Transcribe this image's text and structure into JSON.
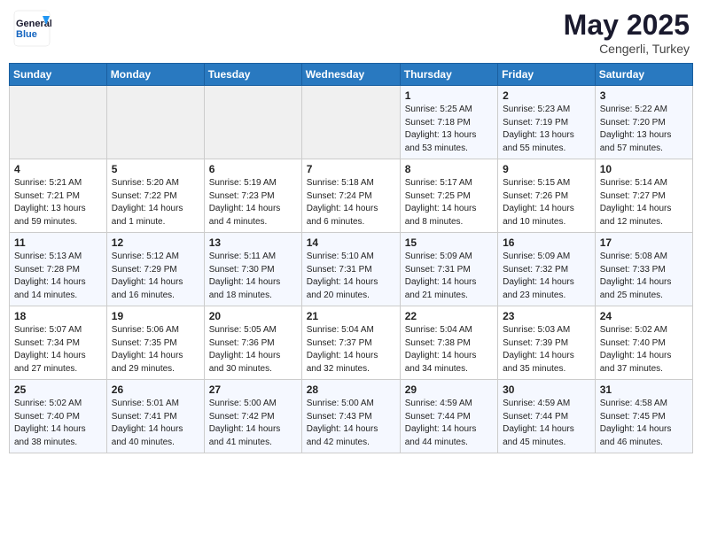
{
  "header": {
    "logo_line1": "General",
    "logo_line2": "Blue",
    "month_year": "May 2025",
    "location": "Cengerli, Turkey"
  },
  "days_of_week": [
    "Sunday",
    "Monday",
    "Tuesday",
    "Wednesday",
    "Thursday",
    "Friday",
    "Saturday"
  ],
  "weeks": [
    [
      {
        "num": "",
        "info": ""
      },
      {
        "num": "",
        "info": ""
      },
      {
        "num": "",
        "info": ""
      },
      {
        "num": "",
        "info": ""
      },
      {
        "num": "1",
        "info": "Sunrise: 5:25 AM\nSunset: 7:18 PM\nDaylight: 13 hours\nand 53 minutes."
      },
      {
        "num": "2",
        "info": "Sunrise: 5:23 AM\nSunset: 7:19 PM\nDaylight: 13 hours\nand 55 minutes."
      },
      {
        "num": "3",
        "info": "Sunrise: 5:22 AM\nSunset: 7:20 PM\nDaylight: 13 hours\nand 57 minutes."
      }
    ],
    [
      {
        "num": "4",
        "info": "Sunrise: 5:21 AM\nSunset: 7:21 PM\nDaylight: 13 hours\nand 59 minutes."
      },
      {
        "num": "5",
        "info": "Sunrise: 5:20 AM\nSunset: 7:22 PM\nDaylight: 14 hours\nand 1 minute."
      },
      {
        "num": "6",
        "info": "Sunrise: 5:19 AM\nSunset: 7:23 PM\nDaylight: 14 hours\nand 4 minutes."
      },
      {
        "num": "7",
        "info": "Sunrise: 5:18 AM\nSunset: 7:24 PM\nDaylight: 14 hours\nand 6 minutes."
      },
      {
        "num": "8",
        "info": "Sunrise: 5:17 AM\nSunset: 7:25 PM\nDaylight: 14 hours\nand 8 minutes."
      },
      {
        "num": "9",
        "info": "Sunrise: 5:15 AM\nSunset: 7:26 PM\nDaylight: 14 hours\nand 10 minutes."
      },
      {
        "num": "10",
        "info": "Sunrise: 5:14 AM\nSunset: 7:27 PM\nDaylight: 14 hours\nand 12 minutes."
      }
    ],
    [
      {
        "num": "11",
        "info": "Sunrise: 5:13 AM\nSunset: 7:28 PM\nDaylight: 14 hours\nand 14 minutes."
      },
      {
        "num": "12",
        "info": "Sunrise: 5:12 AM\nSunset: 7:29 PM\nDaylight: 14 hours\nand 16 minutes."
      },
      {
        "num": "13",
        "info": "Sunrise: 5:11 AM\nSunset: 7:30 PM\nDaylight: 14 hours\nand 18 minutes."
      },
      {
        "num": "14",
        "info": "Sunrise: 5:10 AM\nSunset: 7:31 PM\nDaylight: 14 hours\nand 20 minutes."
      },
      {
        "num": "15",
        "info": "Sunrise: 5:09 AM\nSunset: 7:31 PM\nDaylight: 14 hours\nand 21 minutes."
      },
      {
        "num": "16",
        "info": "Sunrise: 5:09 AM\nSunset: 7:32 PM\nDaylight: 14 hours\nand 23 minutes."
      },
      {
        "num": "17",
        "info": "Sunrise: 5:08 AM\nSunset: 7:33 PM\nDaylight: 14 hours\nand 25 minutes."
      }
    ],
    [
      {
        "num": "18",
        "info": "Sunrise: 5:07 AM\nSunset: 7:34 PM\nDaylight: 14 hours\nand 27 minutes."
      },
      {
        "num": "19",
        "info": "Sunrise: 5:06 AM\nSunset: 7:35 PM\nDaylight: 14 hours\nand 29 minutes."
      },
      {
        "num": "20",
        "info": "Sunrise: 5:05 AM\nSunset: 7:36 PM\nDaylight: 14 hours\nand 30 minutes."
      },
      {
        "num": "21",
        "info": "Sunrise: 5:04 AM\nSunset: 7:37 PM\nDaylight: 14 hours\nand 32 minutes."
      },
      {
        "num": "22",
        "info": "Sunrise: 5:04 AM\nSunset: 7:38 PM\nDaylight: 14 hours\nand 34 minutes."
      },
      {
        "num": "23",
        "info": "Sunrise: 5:03 AM\nSunset: 7:39 PM\nDaylight: 14 hours\nand 35 minutes."
      },
      {
        "num": "24",
        "info": "Sunrise: 5:02 AM\nSunset: 7:40 PM\nDaylight: 14 hours\nand 37 minutes."
      }
    ],
    [
      {
        "num": "25",
        "info": "Sunrise: 5:02 AM\nSunset: 7:40 PM\nDaylight: 14 hours\nand 38 minutes."
      },
      {
        "num": "26",
        "info": "Sunrise: 5:01 AM\nSunset: 7:41 PM\nDaylight: 14 hours\nand 40 minutes."
      },
      {
        "num": "27",
        "info": "Sunrise: 5:00 AM\nSunset: 7:42 PM\nDaylight: 14 hours\nand 41 minutes."
      },
      {
        "num": "28",
        "info": "Sunrise: 5:00 AM\nSunset: 7:43 PM\nDaylight: 14 hours\nand 42 minutes."
      },
      {
        "num": "29",
        "info": "Sunrise: 4:59 AM\nSunset: 7:44 PM\nDaylight: 14 hours\nand 44 minutes."
      },
      {
        "num": "30",
        "info": "Sunrise: 4:59 AM\nSunset: 7:44 PM\nDaylight: 14 hours\nand 45 minutes."
      },
      {
        "num": "31",
        "info": "Sunrise: 4:58 AM\nSunset: 7:45 PM\nDaylight: 14 hours\nand 46 minutes."
      }
    ]
  ]
}
